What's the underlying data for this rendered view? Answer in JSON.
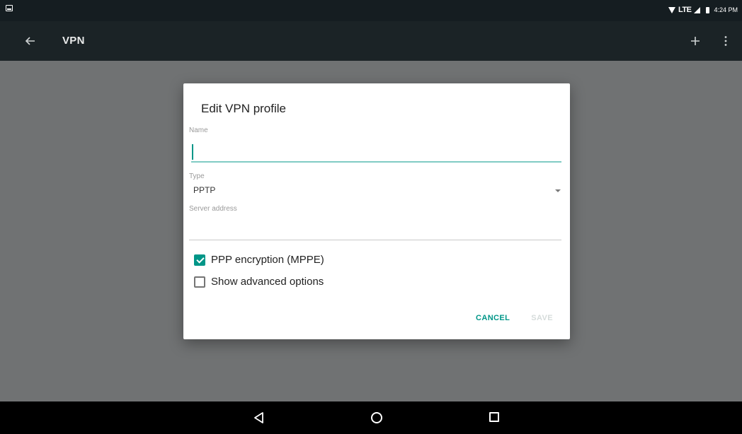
{
  "status_bar": {
    "network": "LTE",
    "time": "4:24 PM",
    "icons": [
      "notification-icon",
      "wifi-icon",
      "signal-icon",
      "battery-icon"
    ]
  },
  "app_bar": {
    "title": "VPN",
    "icons": [
      "back-arrow-icon",
      "add-icon",
      "more-vert-icon"
    ]
  },
  "dialog": {
    "title": "Edit VPN profile",
    "name_field": {
      "label": "Name",
      "value": ""
    },
    "type_field": {
      "label": "Type",
      "value": "PPTP",
      "icon": "dropdown-arrow-icon"
    },
    "server_field": {
      "label": "Server address",
      "value": ""
    },
    "checkboxes": [
      {
        "label": "PPP encryption (MPPE)",
        "checked": true
      },
      {
        "label": "Show advanced options",
        "checked": false
      }
    ],
    "actions": {
      "cancel": "CANCEL",
      "save": "SAVE"
    }
  },
  "nav_bar": {
    "icons": [
      "nav-back-icon",
      "nav-home-icon",
      "nav-recents-icon"
    ]
  },
  "colors": {
    "accent": "#009688",
    "scrim": "#707273",
    "app_bar": "#1b2326",
    "status_bar": "#151d21",
    "disabled_action": "#d6dcdb"
  }
}
